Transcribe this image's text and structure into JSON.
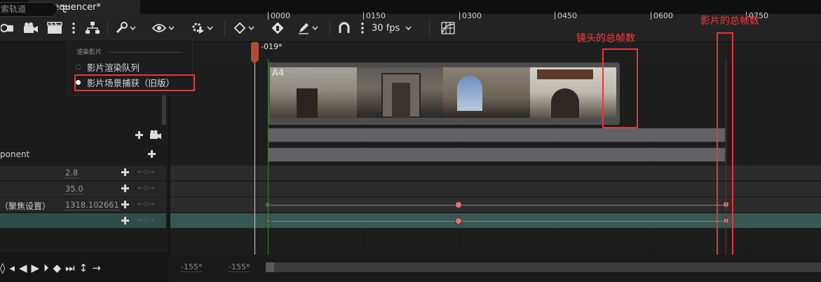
{
  "tab": {
    "title": "Sequencer*"
  },
  "toolbar": {
    "fps": "30 fps"
  },
  "left_panel": {
    "search_placeholder": "索轨道",
    "rows": [
      {
        "label": "ponent"
      },
      {
        "value": "2.8"
      },
      {
        "value": "35.0"
      },
      {
        "label": "（聚焦设置）",
        "value": "1318.102661"
      }
    ]
  },
  "menu": {
    "header": "渲染影片",
    "items": [
      {
        "label": "影片渲染队列"
      },
      {
        "label": "影片场景捕获（旧版）"
      }
    ]
  },
  "timeline": {
    "playhead_label": "-019*",
    "ticks": [
      "0000",
      "0150",
      "0300",
      "0450",
      "0600",
      "0750"
    ],
    "shot": {
      "label": "A4"
    }
  },
  "annotations": {
    "shot_total_frames": "镜头的总帧数",
    "movie_total_frames": "影片的总帧数"
  },
  "bottom": {
    "range_start": "-155*",
    "range_end": "-155*"
  },
  "colors": {
    "accent_red": "#e53838",
    "playhead": "#b24d35",
    "selected_row": "#2f4d48",
    "key": "#e87171"
  }
}
